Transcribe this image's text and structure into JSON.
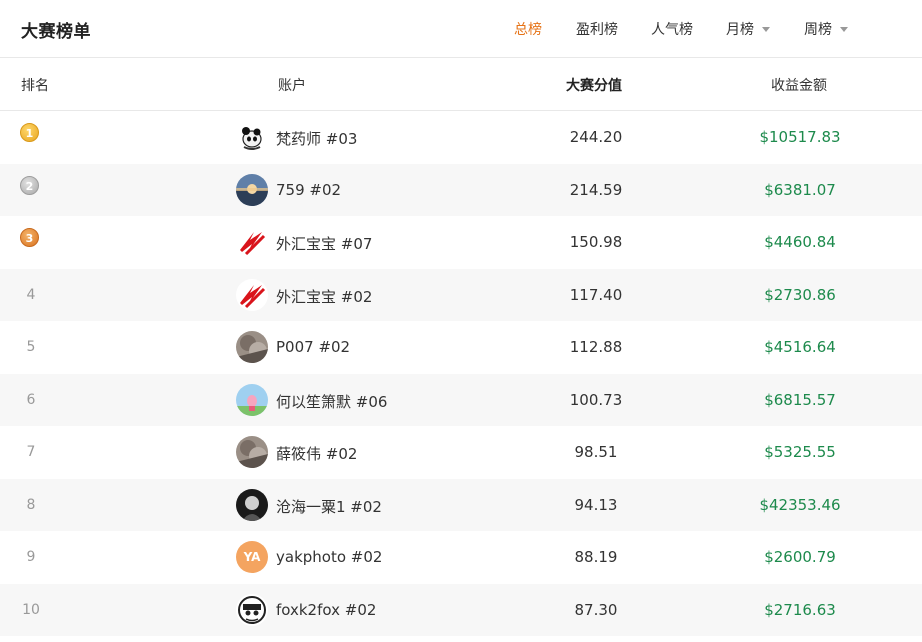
{
  "header": {
    "title": "大赛榜单",
    "tabs": [
      {
        "label": "总榜",
        "active": true,
        "dropdown": false
      },
      {
        "label": "盈利榜",
        "active": false,
        "dropdown": false
      },
      {
        "label": "人气榜",
        "active": false,
        "dropdown": false
      },
      {
        "label": "月榜",
        "active": false,
        "dropdown": true
      },
      {
        "label": "周榜",
        "active": false,
        "dropdown": true
      }
    ]
  },
  "table": {
    "columns": {
      "rank": "排名",
      "account": "账户",
      "score": "大赛分值",
      "profit": "收益金额"
    },
    "rows": [
      {
        "rank": "1",
        "medal": "gold",
        "account": "梵药师 #03",
        "score": "244.20",
        "profit": "$10517.83",
        "avatar": "panda-avatar"
      },
      {
        "rank": "2",
        "medal": "silver",
        "account": "759 #02",
        "score": "214.59",
        "profit": "$6381.07",
        "avatar": "sunset-avatar"
      },
      {
        "rank": "3",
        "medal": "bronze",
        "account": "外汇宝宝 #07",
        "score": "150.98",
        "profit": "$4460.84",
        "avatar": "red-logo-avatar"
      },
      {
        "rank": "4",
        "medal": "",
        "account": "外汇宝宝 #02",
        "score": "117.40",
        "profit": "$2730.86",
        "avatar": "red-logo-avatar"
      },
      {
        "rank": "5",
        "medal": "",
        "account": "P007 #02",
        "score": "112.88",
        "profit": "$4516.64",
        "avatar": "photo-avatar"
      },
      {
        "rank": "6",
        "medal": "",
        "account": "何以笙箫默 #06",
        "score": "100.73",
        "profit": "$6815.57",
        "avatar": "pig-avatar"
      },
      {
        "rank": "7",
        "medal": "",
        "account": "薛筱伟 #02",
        "score": "98.51",
        "profit": "$5325.55",
        "avatar": "photo-avatar"
      },
      {
        "rank": "8",
        "medal": "",
        "account": "沧海一粟1 #02",
        "score": "94.13",
        "profit": "$42353.46",
        "avatar": "dark-photo-avatar"
      },
      {
        "rank": "9",
        "medal": "",
        "account": "yakphoto #02",
        "score": "88.19",
        "profit": "$2600.79",
        "avatar": "initials-avatar",
        "initials": "YA"
      },
      {
        "rank": "10",
        "medal": "",
        "account": "foxk2fox #02",
        "score": "87.30",
        "profit": "$2716.63",
        "avatar": "sketch-avatar"
      }
    ]
  },
  "colors": {
    "accent": "#e67317",
    "profit": "#1d8a4c",
    "row_alt": "#f7f7f7",
    "initials_avatar": "#f4a460"
  }
}
